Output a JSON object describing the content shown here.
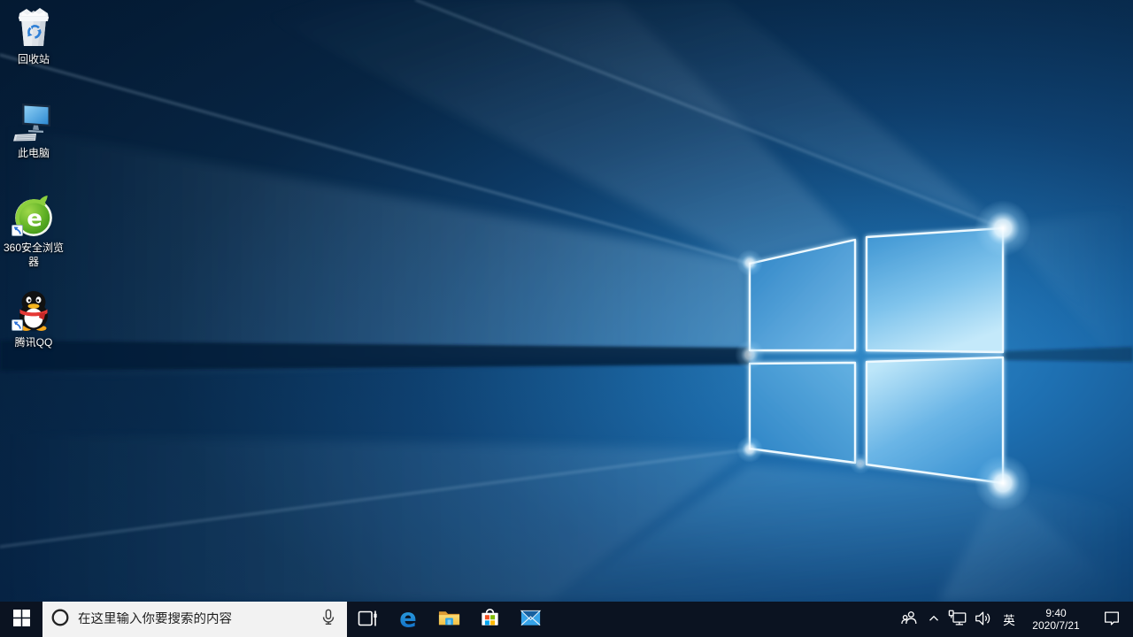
{
  "desktop": {
    "icons": [
      {
        "id": "recycle-bin",
        "label": "回收站",
        "shortcut": false
      },
      {
        "id": "this-pc",
        "label": "此电脑",
        "shortcut": false
      },
      {
        "id": "360-browser",
        "label": "360安全浏览器",
        "letter": "e",
        "shortcut": true
      },
      {
        "id": "tencent-qq",
        "label": "腾讯QQ",
        "shortcut": true
      }
    ]
  },
  "taskbar": {
    "search": {
      "placeholder": "在这里输入你要搜索的内容"
    },
    "apps": {
      "edge_letter": "e"
    },
    "tray": {
      "ime": "英",
      "clock": {
        "time": "9:40",
        "date": "2020/7/21"
      }
    }
  },
  "icons": {
    "desktop": [
      "recycle-bin-icon",
      "this-pc-icon",
      "360-browser-icon",
      "qq-penguin-icon",
      "shortcut-arrow-icon"
    ],
    "taskbar": [
      "start-windows-icon",
      "cortana-circle-icon",
      "microphone-icon",
      "task-view-icon",
      "edge-icon",
      "file-explorer-icon",
      "store-icon",
      "mail-icon"
    ],
    "tray": [
      "people-icon",
      "chevron-up-icon",
      "network-ethernet-icon",
      "volume-icon",
      "action-center-icon"
    ]
  },
  "colors": {
    "taskbar_bg": "#0b1321",
    "search_box_bg": "#f2f2f2",
    "search_text": "#1f1f1f",
    "wallpaper_dark": "#08274a",
    "wallpaper_blue": "#1c6cae",
    "logo_pane_bright": "#bfe7f9",
    "logo_pane_blue": "#3f96d3",
    "accent": "#0078d7"
  }
}
